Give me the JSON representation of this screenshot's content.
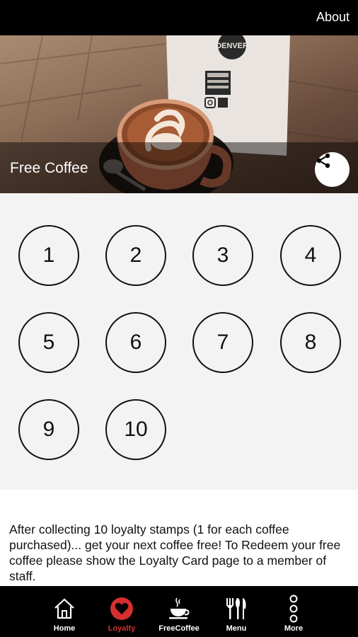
{
  "header": {
    "about_label": "About"
  },
  "hero": {
    "title": "Free Coffee",
    "sign_text": "DENVER"
  },
  "stamps": [
    "1",
    "2",
    "3",
    "4",
    "5",
    "6",
    "7",
    "8",
    "9",
    "10"
  ],
  "info": {
    "text": "After collecting 10 loyalty stamps (1 for each coffee purchased)... get your next coffee free! To Redeem your free coffee please show the Loyalty Card page to a member of staff."
  },
  "tabs": [
    {
      "label": "Home",
      "icon": "home-icon",
      "active": false
    },
    {
      "label": "Loyalty",
      "icon": "heart-icon",
      "active": true
    },
    {
      "label": "FreeCoffee",
      "icon": "coffee-cup-icon",
      "active": false
    },
    {
      "label": "Menu",
      "icon": "cutlery-icon",
      "active": false
    },
    {
      "label": "More",
      "icon": "more-dots-icon",
      "active": false
    }
  ],
  "colors": {
    "active_tab": "#d32f2f",
    "background": "#f3f3f3",
    "bar": "#000000"
  }
}
